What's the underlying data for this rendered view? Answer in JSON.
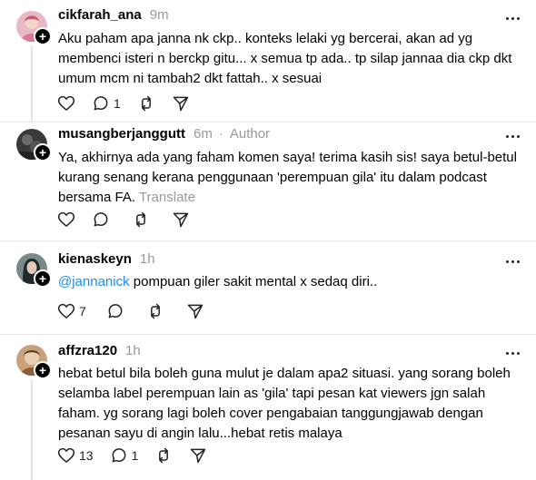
{
  "posts": [
    {
      "username": "cikfarah_ana",
      "time": "9m",
      "author_label": "",
      "text": "Aku paham apa janna nk ckp.. konteks lelaki yg bercerai, akan ad yg membenci isteri n berckp gitu... x semua tp ada.. tp silap jannaa dia ckp dkt umum mcm ni tambah2 dkt fattah.. x sesuai",
      "like_count": "",
      "reply_count": "1"
    },
    {
      "username": "musangberjanggutt",
      "time": "6m",
      "separator": "·",
      "author_label": "Author",
      "text": "Ya, akhirnya ada yang faham komen saya! terima kasih sis! saya betul-betul kurang senang kerana penggunaan 'perempuan gila' itu dalam podcast bersama FA.",
      "translate_label": "Translate",
      "like_count": "",
      "reply_count": ""
    },
    {
      "username": "kienaskeyn",
      "time": "1h",
      "mention": "@jannanick",
      "text": " pompuan giler sakit mental x sedaq diri..",
      "like_count": "7",
      "reply_count": ""
    },
    {
      "username": "affzra120",
      "time": "1h",
      "text": "hebat betul bila boleh guna mulut je dalam apa2 situasi. yang sorang boleh selamba label perempuan lain as 'gila' tapi pesan kat viewers jgn salah faham. yg sorang lagi boleh cover pengabaian tanggungjawab dengan pesanan sayu di angin lalu...hebat retis malaya",
      "like_count": "13",
      "reply_count": "1"
    }
  ],
  "icons": [
    "heart-icon",
    "reply-icon",
    "repost-icon",
    "share-icon",
    "more-icon",
    "follow-plus-icon"
  ]
}
